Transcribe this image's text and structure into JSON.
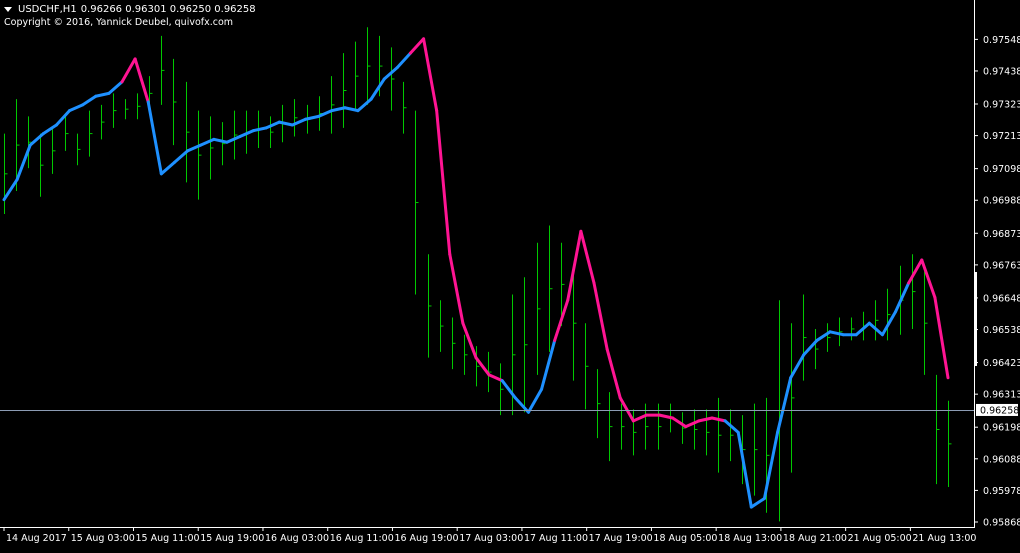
{
  "window": {
    "symbol_label": "USDCHF,H1",
    "ohlc_label": "0.96266 0.96301 0.96250 0.96258",
    "copyright": "Copyright © 2016, Yannick Deubel, quivofx.com",
    "dropdown_icon": "triangle-down-icon"
  },
  "colors": {
    "background": "#000000",
    "axis": "#ffffff",
    "price_bars": "#00c800",
    "ma_up": "#1e90ff",
    "ma_down": "#ff1493",
    "current_price_line": "#8c9cb4"
  },
  "chart_data": {
    "type": "line",
    "instrument": "USDCHF",
    "timeframe": "H1",
    "ylim": [
      0.95868,
      0.97598
    ],
    "y_ticks": [
      "0.97548",
      "0.97438",
      "0.97323",
      "0.97213",
      "0.97098",
      "0.96988",
      "0.96873",
      "0.96763",
      "0.96648",
      "0.96538",
      "0.96423",
      "0.96313",
      "0.96198",
      "0.96088",
      "0.95978",
      "0.95868"
    ],
    "x_ticks": [
      "14 Aug 2017",
      "15 Aug 03:00",
      "15 Aug 11:00",
      "15 Aug 19:00",
      "16 Aug 03:00",
      "16 Aug 11:00",
      "16 Aug 19:00",
      "17 Aug 03:00",
      "17 Aug 11:00",
      "17 Aug 19:00",
      "18 Aug 05:00",
      "18 Aug 13:00",
      "18 Aug 21:00",
      "21 Aug 05:00",
      "21 Aug 13:00"
    ],
    "current_price": "0.96258",
    "grid": false,
    "series": [
      {
        "kind": "ohlc_bars",
        "values": [
          [
            0.9694,
            0.9722
          ],
          [
            0.9702,
            0.9734
          ],
          [
            0.971,
            0.9728
          ],
          [
            0.97,
            0.9722
          ],
          [
            0.9708,
            0.9724
          ],
          [
            0.9716,
            0.9728
          ],
          [
            0.9711,
            0.9722
          ],
          [
            0.9714,
            0.973
          ],
          [
            0.972,
            0.9732
          ],
          [
            0.9724,
            0.9736
          ],
          [
            0.9727,
            0.9734
          ],
          [
            0.9727,
            0.9736
          ],
          [
            0.973,
            0.9742
          ],
          [
            0.9732,
            0.9756
          ],
          [
            0.9718,
            0.9748
          ],
          [
            0.9705,
            0.974
          ],
          [
            0.9699,
            0.973
          ],
          [
            0.9706,
            0.9728
          ],
          [
            0.9711,
            0.9726
          ],
          [
            0.9713,
            0.973
          ],
          [
            0.9715,
            0.973
          ],
          [
            0.9717,
            0.973
          ],
          [
            0.9717,
            0.9728
          ],
          [
            0.9719,
            0.9732
          ],
          [
            0.9721,
            0.9734
          ],
          [
            0.9722,
            0.9732
          ],
          [
            0.9723,
            0.9735
          ],
          [
            0.9722,
            0.9742
          ],
          [
            0.9724,
            0.975
          ],
          [
            0.973,
            0.9754
          ],
          [
            0.9732,
            0.9759
          ],
          [
            0.9735,
            0.9756
          ],
          [
            0.973,
            0.9752
          ],
          [
            0.9722,
            0.974
          ],
          [
            0.9666,
            0.973
          ],
          [
            0.9644,
            0.968
          ],
          [
            0.9646,
            0.9664
          ],
          [
            0.964,
            0.9658
          ],
          [
            0.9638,
            0.9652
          ],
          [
            0.9634,
            0.9648
          ],
          [
            0.9632,
            0.9646
          ],
          [
            0.9624,
            0.9642
          ],
          [
            0.9624,
            0.9666
          ],
          [
            0.9625,
            0.9672
          ],
          [
            0.9638,
            0.9684
          ],
          [
            0.9646,
            0.969
          ],
          [
            0.9655,
            0.9684
          ],
          [
            0.9636,
            0.9676
          ],
          [
            0.9626,
            0.9656
          ],
          [
            0.9616,
            0.964
          ],
          [
            0.9608,
            0.9632
          ],
          [
            0.9612,
            0.9628
          ],
          [
            0.961,
            0.9626
          ],
          [
            0.9612,
            0.9628
          ],
          [
            0.9612,
            0.9628
          ],
          [
            0.9618,
            0.9628
          ],
          [
            0.9614,
            0.9625
          ],
          [
            0.9612,
            0.9626
          ],
          [
            0.961,
            0.9626
          ],
          [
            0.9604,
            0.963
          ],
          [
            0.9608,
            0.9626
          ],
          [
            0.96,
            0.9624
          ],
          [
            0.9596,
            0.9628
          ],
          [
            0.959,
            0.963
          ],
          [
            0.9587,
            0.9664
          ],
          [
            0.9604,
            0.9656
          ],
          [
            0.9636,
            0.9666
          ],
          [
            0.964,
            0.9654
          ],
          [
            0.9646,
            0.9656
          ],
          [
            0.9648,
            0.9658
          ],
          [
            0.965,
            0.9658
          ],
          [
            0.965,
            0.966
          ],
          [
            0.965,
            0.9664
          ],
          [
            0.965,
            0.9668
          ],
          [
            0.9652,
            0.9676
          ],
          [
            0.9654,
            0.968
          ],
          [
            0.9638,
            0.9674
          ],
          [
            0.96,
            0.9638
          ],
          [
            0.9599,
            0.9629
          ]
        ]
      },
      {
        "name": "",
        "kind": "moving_average",
        "values": [
          0.9699,
          0.9706,
          0.9718,
          0.9722,
          0.9725,
          0.973,
          0.9732,
          0.9735,
          0.9736,
          0.974,
          0.9748,
          0.9733,
          0.9708,
          0.9712,
          0.9716,
          0.9718,
          0.972,
          0.9719,
          0.9721,
          0.9723,
          0.9724,
          0.9726,
          0.9725,
          0.9727,
          0.9728,
          0.973,
          0.9731,
          0.973,
          0.9734,
          0.9741,
          0.9745,
          0.975,
          0.9755,
          0.973,
          0.968,
          0.9656,
          0.9644,
          0.9638,
          0.9636,
          0.963,
          0.9625,
          0.9633,
          0.965,
          0.9664,
          0.9688,
          0.967,
          0.9647,
          0.963,
          0.9622,
          0.9624,
          0.9624,
          0.9623,
          0.962,
          0.9622,
          0.9623,
          0.9622,
          0.9618,
          0.9592,
          0.9595,
          0.9618,
          0.9637,
          0.9645,
          0.965,
          0.9653,
          0.9652,
          0.9652,
          0.9656,
          0.9652,
          0.966,
          0.967,
          0.9678,
          0.9665,
          0.9637
        ],
        "trend": [
          "up",
          "up",
          "up",
          "up",
          "up",
          "up",
          "up",
          "up",
          "up",
          "up",
          "down",
          "down",
          "up",
          "up",
          "up",
          "up",
          "up",
          "up",
          "up",
          "up",
          "up",
          "up",
          "up",
          "up",
          "up",
          "up",
          "up",
          "up",
          "up",
          "up",
          "up",
          "up",
          "down",
          "down",
          "down",
          "down",
          "down",
          "down",
          "down",
          "up",
          "up",
          "up",
          "up",
          "down",
          "down",
          "down",
          "down",
          "down",
          "down",
          "down",
          "down",
          "down",
          "down",
          "down",
          "down",
          "down",
          "up",
          "up",
          "up",
          "up",
          "up",
          "up",
          "up",
          "up",
          "up",
          "up",
          "up",
          "up",
          "up",
          "up",
          "down",
          "down",
          "down"
        ]
      }
    ]
  }
}
